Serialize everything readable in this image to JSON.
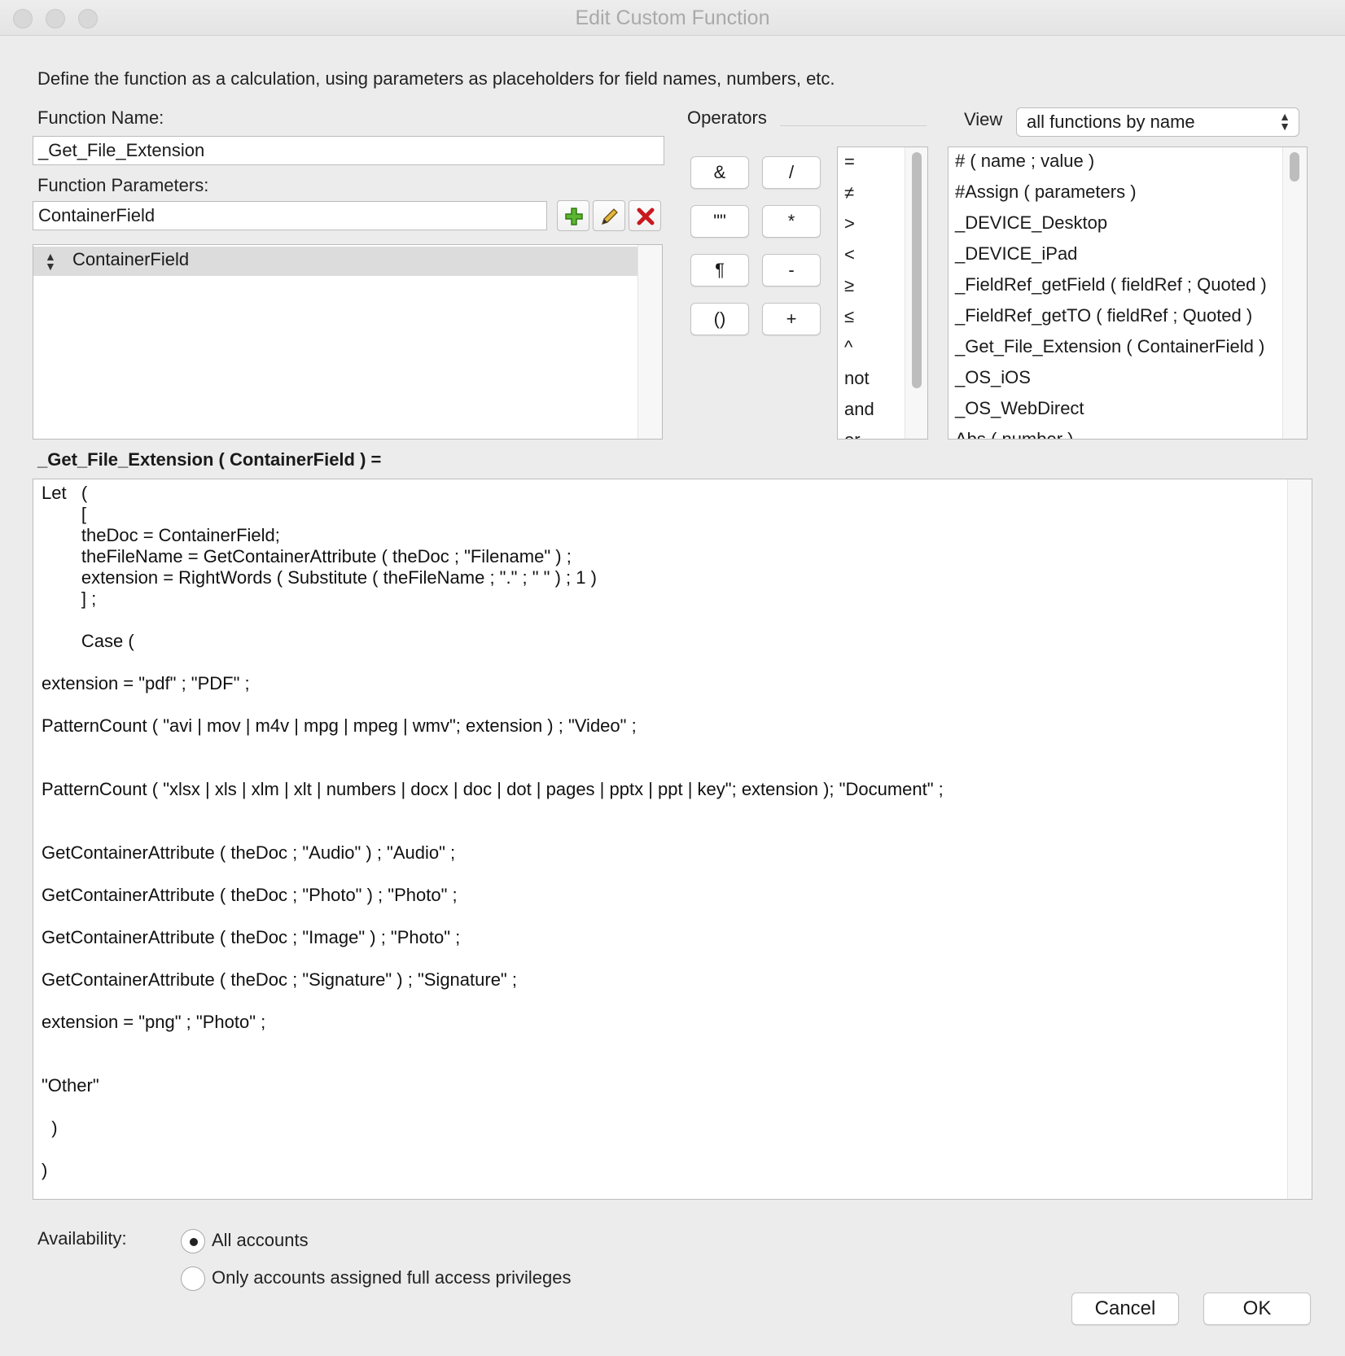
{
  "window": {
    "title": "Edit Custom Function"
  },
  "instructions": "Define the function as a calculation, using parameters as placeholders for field names, numbers, etc.",
  "function_name": {
    "label": "Function Name:",
    "value": "_Get_File_Extension"
  },
  "function_parameters": {
    "label": "Function Parameters:",
    "value": "ContainerField",
    "add_icon": "plus-icon",
    "edit_icon": "pencil-icon",
    "delete_icon": "delete-x-icon",
    "items": [
      "ContainerField"
    ]
  },
  "operators": {
    "label": "Operators",
    "buttons": [
      "&",
      "/",
      "\"\"",
      "*",
      "¶",
      "-",
      "()",
      "+"
    ],
    "list": [
      "=",
      "≠",
      ">",
      "<",
      "≥",
      "≤",
      "^",
      "not",
      "and",
      "or"
    ]
  },
  "view": {
    "label": "View",
    "selected": "all functions by name",
    "functions": [
      "# ( name ; value )",
      "#Assign ( parameters )",
      "_DEVICE_Desktop",
      "_DEVICE_iPad",
      "_FieldRef_getField ( fieldRef ; Quoted )",
      "_FieldRef_getTO ( fieldRef ; Quoted )",
      "_Get_File_Extension ( ContainerField )",
      "_OS_iOS",
      "_OS_WebDirect",
      "Abs ( number )"
    ]
  },
  "calculation": {
    "header": "_Get_File_Extension ( ContainerField ) =",
    "code": "Let   (\n        [\n        theDoc = ContainerField;\n        theFileName = GetContainerAttribute ( theDoc ; \"Filename\" ) ;\n        extension = RightWords ( Substitute ( theFileName ; \".\" ; \" \" ) ; 1 )\n        ] ;\n\n        Case (\n\nextension = \"pdf\" ; \"PDF\" ;\n\nPatternCount ( \"avi | mov | m4v | mpg | mpeg | wmv\"; extension ) ; \"Video\" ;\n\n\nPatternCount ( \"xlsx | xls | xlm | xlt | numbers | docx | doc | dot | pages | pptx | ppt | key\"; extension ); \"Document\" ;\n\n\nGetContainerAttribute ( theDoc ; \"Audio\" ) ; \"Audio\" ;\n\nGetContainerAttribute ( theDoc ; \"Photo\" ) ; \"Photo\" ;\n\nGetContainerAttribute ( theDoc ; \"Image\" ) ; \"Photo\" ;\n\nGetContainerAttribute ( theDoc ; \"Signature\" ) ; \"Signature\" ;\n\nextension = \"png\" ; \"Photo\" ;\n\n\n\"Other\"\n\n  )\n\n)"
  },
  "availability": {
    "label": "Availability:",
    "options": [
      "All accounts",
      "Only accounts assigned full access privileges"
    ],
    "selected": "All accounts"
  },
  "buttons": {
    "cancel": "Cancel",
    "ok": "OK"
  }
}
